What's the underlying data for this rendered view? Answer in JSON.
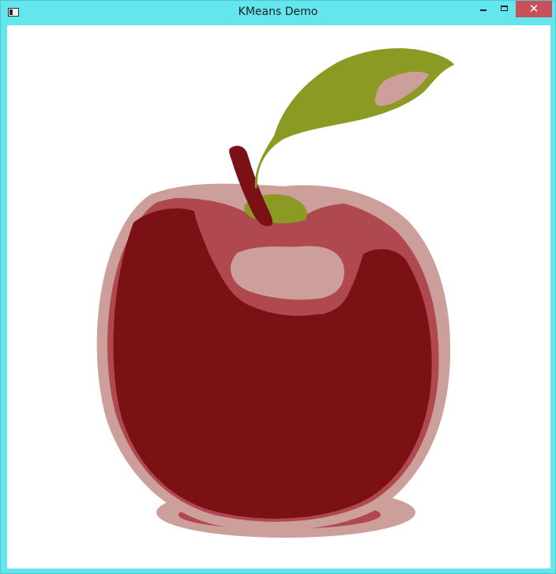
{
  "window": {
    "title": "KMeans Demo",
    "close_glyph": "✕"
  },
  "icons": {
    "app": "app-window-icon",
    "minimize": "minimize-icon",
    "maximize": "maximize-icon",
    "close": "close-icon"
  },
  "colors": {
    "frame": "#64e6ee",
    "close_button": "#c7505a",
    "canvas_background": "#ffffff",
    "cluster_dark_red": "#7b1114",
    "cluster_mid_red": "#b04850",
    "cluster_pink": "#cc9f9b",
    "cluster_olive": "#8a9a22"
  },
  "canvas": {
    "image": "apple-kmeans-segmented"
  }
}
